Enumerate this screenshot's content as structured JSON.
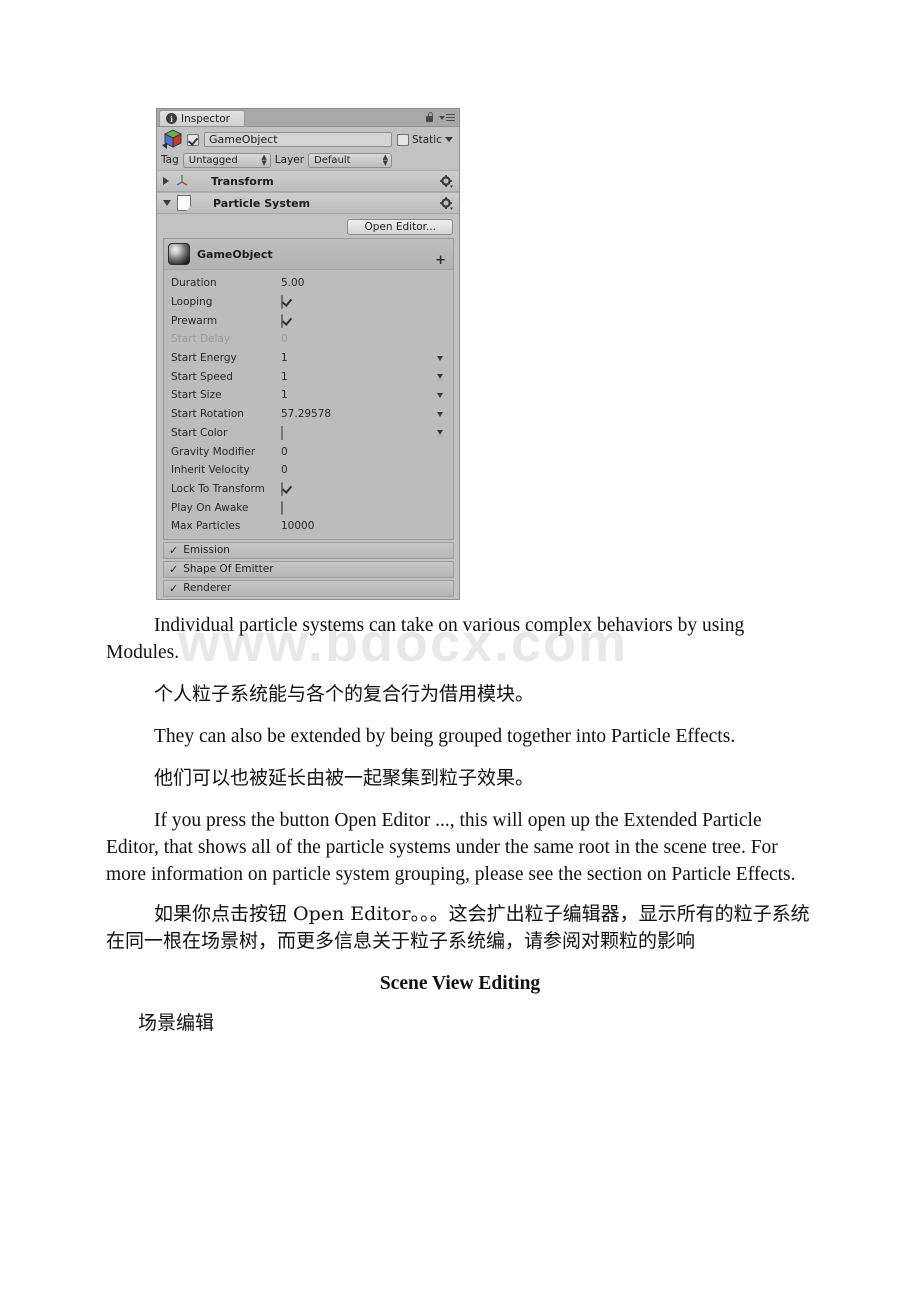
{
  "watermark": {
    "text": "www.bdocx.com"
  },
  "inspector": {
    "tab": {
      "label": "Inspector",
      "icon": "info-icon"
    },
    "header_icons": {
      "lock": "lock-icon",
      "menu": "menu-icon"
    },
    "object": {
      "enabled_checkbox": true,
      "name": "GameObject",
      "static_label": "Static",
      "static_checked": false,
      "tag_label": "Tag",
      "tag_value": "Untagged",
      "layer_label": "Layer",
      "layer_value": "Default"
    },
    "components": [
      {
        "title": "Transform",
        "expanded": false,
        "icon": "transform-axis-icon"
      },
      {
        "title": "Particle System",
        "expanded": true,
        "icon": "script-document-icon"
      }
    ],
    "open_editor_button": "Open Editor...",
    "module": {
      "name": "GameObject",
      "add_button": "+",
      "properties": [
        {
          "label": "Duration",
          "value": "5.00",
          "type": "text",
          "caret": false,
          "disabled": false
        },
        {
          "label": "Looping",
          "value": "",
          "type": "checkbox",
          "checked": true,
          "caret": false,
          "disabled": false
        },
        {
          "label": "Prewarm",
          "value": "",
          "type": "checkbox",
          "checked": true,
          "caret": false,
          "disabled": false
        },
        {
          "label": "Start Delay",
          "value": "0",
          "type": "text",
          "caret": false,
          "disabled": true
        },
        {
          "label": "Start Energy",
          "value": "1",
          "type": "text",
          "caret": true,
          "disabled": false
        },
        {
          "label": "Start Speed",
          "value": "1",
          "type": "text",
          "caret": true,
          "disabled": false
        },
        {
          "label": "Start Size",
          "value": "1",
          "type": "text",
          "caret": true,
          "disabled": false
        },
        {
          "label": "Start Rotation",
          "value": "57.29578",
          "type": "text",
          "caret": true,
          "disabled": false
        },
        {
          "label": "Start Color",
          "value": "#ffffff",
          "type": "color",
          "caret": true,
          "disabled": false
        },
        {
          "label": "Gravity Modifier",
          "value": "0",
          "type": "text",
          "caret": false,
          "disabled": false
        },
        {
          "label": "Inherit Velocity",
          "value": "0",
          "type": "text",
          "caret": false,
          "disabled": false
        },
        {
          "label": "Lock To Transform",
          "value": "",
          "type": "checkbox",
          "checked": true,
          "caret": false,
          "disabled": false
        },
        {
          "label": "Play On Awake",
          "value": "",
          "type": "checkbox",
          "checked": false,
          "caret": false,
          "disabled": false
        },
        {
          "label": "Max Particles",
          "value": "10000",
          "type": "text",
          "caret": false,
          "disabled": false
        }
      ]
    },
    "sub_modules": [
      {
        "label": "Emission",
        "checked": true,
        "tick": "✓"
      },
      {
        "label": "Shape Of Emitter",
        "checked": true,
        "tick": "✓"
      },
      {
        "label": "Renderer",
        "checked": true,
        "tick": "✓"
      }
    ]
  },
  "document": {
    "paragraphs": [
      {
        "lang": "en",
        "text": "Individual particle systems can take on various complex behaviors by using Modules."
      },
      {
        "lang": "cn",
        "text": "个人粒子系统能与各个的复合行为借用模块。"
      },
      {
        "lang": "en",
        "text": "They can also be extended by being grouped together into Particle Effects."
      },
      {
        "lang": "cn",
        "text": "他们可以也被延长由被一起聚集到粒子效果。"
      },
      {
        "lang": "en",
        "text": "If you press the button Open Editor ..., this will open up the Extended Particle Editor, that shows all of the particle systems under the same root in the scene tree. For more information on particle system grouping, please see the section on Particle Effects."
      },
      {
        "lang": "cn",
        "text": "如果你点击按钮 Open Editor。。。这会扩出粒子编辑器，显示所有的粒子系统在同一根在场景树，而更多信息关于粒子系统编，请参阅对颗粒的影响"
      }
    ],
    "heading": "Scene View Editing",
    "heading_cn": "场景编辑"
  }
}
